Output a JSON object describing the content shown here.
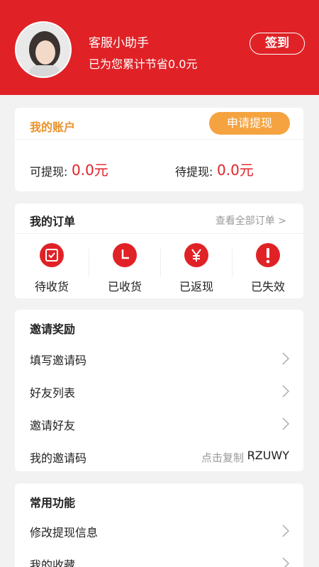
{
  "profile": {
    "name": "客服小助手",
    "saved_text": "已为您累计节省0.0元",
    "signin_label": "签到"
  },
  "account": {
    "title": "我的账户",
    "withdraw_button": "申请提现",
    "available_label": "可提现:",
    "available_value": "0.0元",
    "pending_label": "待提现:",
    "pending_value": "0.0元"
  },
  "orders": {
    "title": "我的订单",
    "view_all": "查看全部订单 >",
    "items": [
      {
        "label": "待收货",
        "icon": "pending-receipt-icon"
      },
      {
        "label": "已收货",
        "icon": "clock-icon"
      },
      {
        "label": "已返现",
        "icon": "yen-icon"
      },
      {
        "label": "已失效",
        "icon": "exclamation-icon"
      }
    ]
  },
  "invite": {
    "title": "邀请奖励",
    "rows": [
      {
        "label": "填写邀请码"
      },
      {
        "label": "好友列表"
      },
      {
        "label": "邀请好友"
      }
    ],
    "my_code_label": "我的邀请码",
    "copy_hint": "点击复制",
    "code": "RZUWY"
  },
  "common": {
    "title": "常用功能",
    "rows": [
      {
        "label": "修改提现信息"
      },
      {
        "label": "我的收藏"
      }
    ]
  },
  "colors": {
    "brand_red": "#e02227",
    "accent_orange": "#f5a340"
  }
}
